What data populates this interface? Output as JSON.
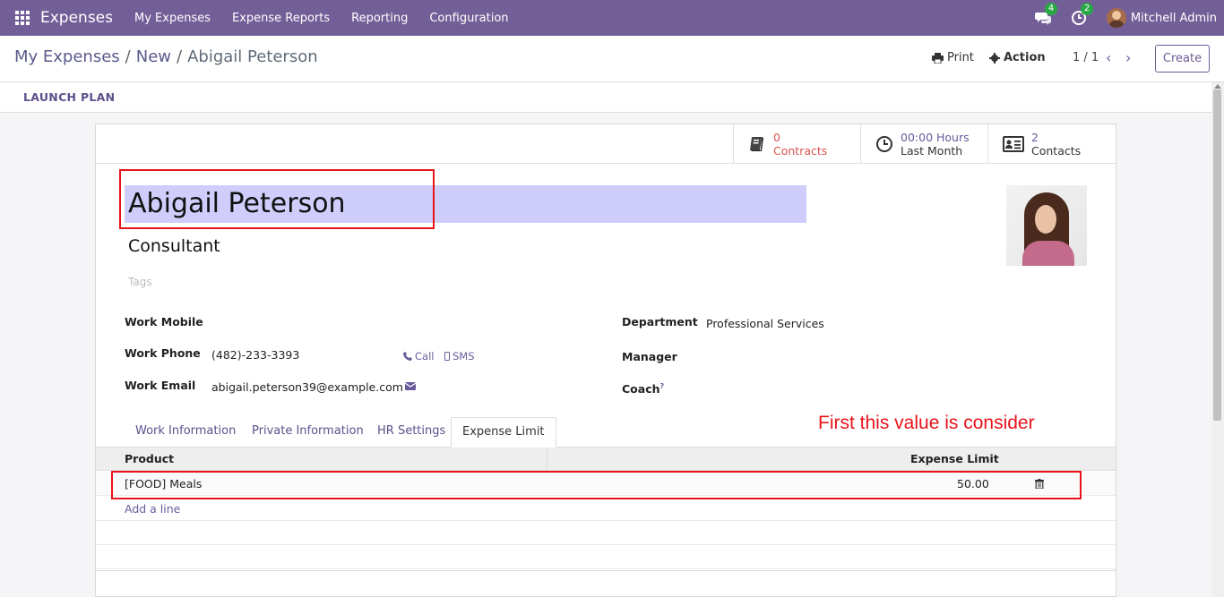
{
  "navbar": {
    "app_name": "Expenses",
    "menu": [
      "My Expenses",
      "Expense Reports",
      "Reporting",
      "Configuration"
    ],
    "messages_count": "4",
    "activities_count": "2",
    "user_name": "Mitchell Admin",
    "bg_color": "#735f98"
  },
  "control": {
    "breadcrumb": [
      "My Expenses",
      "New",
      "Abigail Peterson"
    ],
    "print_label": "Print",
    "action_label": "Action",
    "pager": "1 / 1",
    "create_label": "Create"
  },
  "statusbar": {
    "launch_plan": "LAUNCH PLAN"
  },
  "stats": [
    {
      "value": "0",
      "label": "Contracts",
      "icon": "book-icon"
    },
    {
      "value": "00:00 Hours",
      "label": "Last Month",
      "icon": "clock-icon"
    },
    {
      "value": "2",
      "label": "Contacts",
      "icon": "id-card-icon"
    }
  ],
  "employee": {
    "name": "Abigail Peterson",
    "job_title": "Consultant",
    "tags_placeholder": "Tags"
  },
  "fields": {
    "work_mobile_label": "Work Mobile",
    "work_phone_label": "Work Phone",
    "work_phone": "(482)-233-3393",
    "call_label": "Call",
    "sms_label": "SMS",
    "work_email_label": "Work Email",
    "work_email": "abigail.peterson39@example.com",
    "department_label": "Department",
    "department": "Professional Services",
    "manager_label": "Manager",
    "coach_label": "Coach",
    "coach_help": "?"
  },
  "tabs": [
    "Work Information",
    "Private Information",
    "HR Settings",
    "Expense Limit"
  ],
  "active_tab": "Expense Limit",
  "annotation": "First this value is consider",
  "expense_table": {
    "headers": {
      "product": "Product",
      "limit": "Expense Limit"
    },
    "rows": [
      {
        "product": "[FOOD] Meals",
        "limit": "50.00"
      }
    ],
    "add_line": "Add a line"
  }
}
